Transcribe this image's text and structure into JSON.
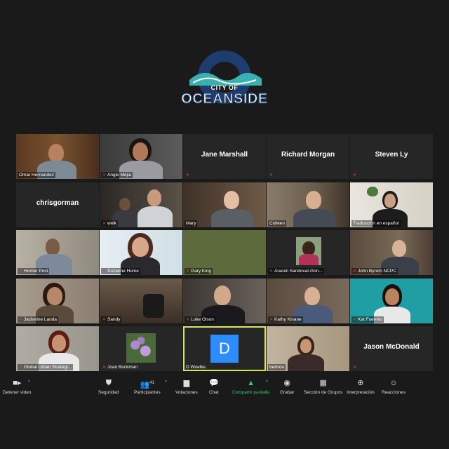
{
  "logo": {
    "line1": "CITY OF",
    "line2": "OCEANSIDE"
  },
  "tiles": [
    {
      "label": "Omar Hernandez",
      "name": ""
    },
    {
      "label": "Angie Mejia",
      "name": ""
    },
    {
      "label": "",
      "name": "Jane Marshall"
    },
    {
      "label": "",
      "name": "Richard Morgan"
    },
    {
      "label": "",
      "name": "Steven Ly"
    },
    {
      "label": "",
      "name": "chrisgorman"
    },
    {
      "label": "welk",
      "name": ""
    },
    {
      "label": "Mary",
      "name": ""
    },
    {
      "label": "Colleen",
      "name": ""
    },
    {
      "label": "Traducción en español",
      "name": ""
    },
    {
      "label": "Homer Post",
      "name": ""
    },
    {
      "label": "Suzanne Hume",
      "name": ""
    },
    {
      "label": "Gary King",
      "name": ""
    },
    {
      "label": "Araceli Sandoval-Gon...",
      "name": ""
    },
    {
      "label": "John Byrom NCPC",
      "name": ""
    },
    {
      "label": "Jackeline Landa",
      "name": ""
    },
    {
      "label": "Sandy",
      "name": ""
    },
    {
      "label": "Luke Olson",
      "name": ""
    },
    {
      "label": "Kathy Kinane",
      "name": ""
    },
    {
      "label": "Kat Fuentes",
      "name": ""
    },
    {
      "label": "Global Urban Strategi...",
      "name": ""
    },
    {
      "label": "Joan Bockman",
      "name": ""
    },
    {
      "label": "D Woelke",
      "name": "",
      "avatar": "D"
    },
    {
      "label": "belinda",
      "name": ""
    },
    {
      "label": "",
      "name": "Jason McDonald"
    }
  ],
  "toolbar": {
    "stop_video": "Detener video",
    "security": "Seguridad",
    "participants": "Participantes",
    "participants_count": "41",
    "polls": "Votaciones",
    "chat": "Chat",
    "share": "Compartir pantalla",
    "record": "Grabar",
    "breakout": "Sección de Grupos",
    "interpretation": "Interpretación",
    "reactions": "Reacciones"
  }
}
